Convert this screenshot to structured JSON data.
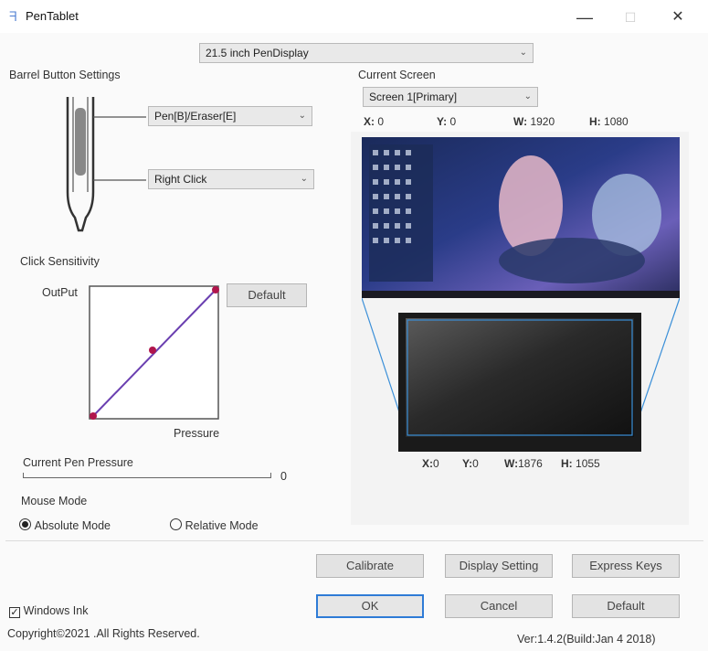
{
  "window": {
    "title": "PenTablet",
    "minimize_glyph": "—",
    "maximize_glyph": "☐",
    "close_glyph": "✕"
  },
  "device_select": {
    "value": "21.5 inch PenDisplay"
  },
  "barrel": {
    "heading": "Barrel Button Settings",
    "upper_button": "Pen[B]/Eraser[E]",
    "lower_button": "Right Click"
  },
  "sensitivity": {
    "heading": "Click Sensitivity",
    "output_label": "OutPut",
    "pressure_label": "Pressure",
    "default_button": "Default",
    "curve_color": "#6a3fb0",
    "point_color": "#b0154c"
  },
  "current_pressure": {
    "heading": "Current Pen Pressure",
    "value": "0",
    "level": 0
  },
  "mouse_mode": {
    "heading": "Mouse Mode",
    "absolute": "Absolute Mode",
    "relative": "Relative Mode",
    "selected": "absolute"
  },
  "screen": {
    "heading": "Current Screen",
    "select_value": "Screen 1[Primary]",
    "x_label": "X:",
    "x_value": "0",
    "y_label": "Y:",
    "y_value": "0",
    "w_label": "W:",
    "w_value": "1920",
    "h_label": "H:",
    "h_value": "1080"
  },
  "tablet_area": {
    "x_label": "X:",
    "x_value": "0",
    "y_label": "Y:",
    "y_value": "0",
    "w_label": "W:",
    "w_value": "1876",
    "h_label": "H:",
    "h_value": "1055"
  },
  "buttons": {
    "calibrate": "Calibrate",
    "display_setting": "Display Setting",
    "express_keys": "Express Keys",
    "ok": "OK",
    "cancel": "Cancel",
    "default": "Default"
  },
  "windows_ink": {
    "label": "Windows Ink",
    "checked": true
  },
  "footer": {
    "copyright": "Copyright©2021  .All Rights Reserved.",
    "version": "Ver:1.4.2(Build:Jan  4 2018)"
  },
  "colors": {
    "accent": "#2e7bd6",
    "mapping_line": "#3a8fd8"
  }
}
